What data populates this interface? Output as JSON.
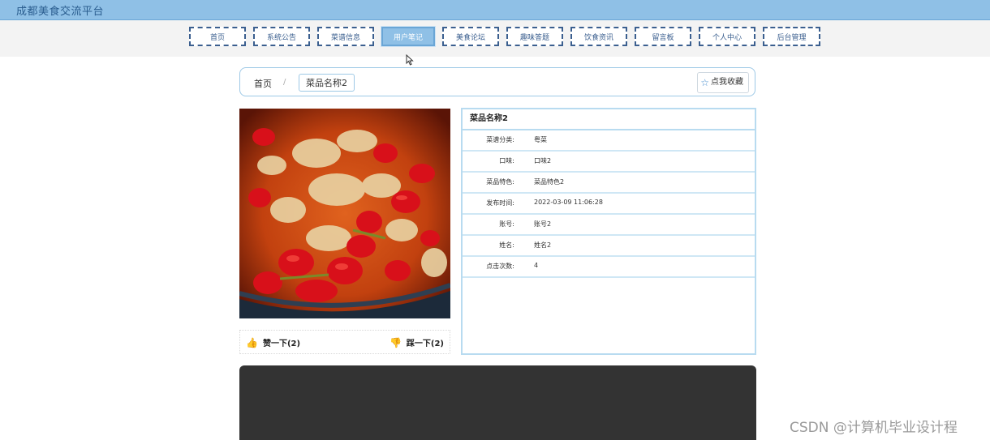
{
  "header": {
    "site_title": "成都美食交流平台",
    "bar_color": "#8fc0e6"
  },
  "nav": {
    "items": [
      {
        "label": "首页",
        "name": "nav-home"
      },
      {
        "label": "系统公告",
        "name": "nav-announcements"
      },
      {
        "label": "菜谱信息",
        "name": "nav-recipes"
      },
      {
        "label": "用户笔记",
        "name": "nav-user-notes",
        "active": true
      },
      {
        "label": "美食论坛",
        "name": "nav-forum"
      },
      {
        "label": "趣味答题",
        "name": "nav-quiz"
      },
      {
        "label": "饮食资讯",
        "name": "nav-news"
      },
      {
        "label": "留言板",
        "name": "nav-message-board"
      },
      {
        "label": "个人中心",
        "name": "nav-profile"
      },
      {
        "label": "后台管理",
        "name": "nav-admin"
      }
    ]
  },
  "breadcrumb": {
    "home": "首页",
    "separator": "/",
    "current": "菜品名称2"
  },
  "favorite_button": {
    "icon": "star-icon",
    "label": "点我收藏"
  },
  "votes": {
    "like": {
      "icon": "thumbs-up-icon",
      "label": "赞一下(2)"
    },
    "dislike": {
      "icon": "thumbs-down-icon",
      "label": "踩一下(2)"
    }
  },
  "detail": {
    "title": "菜品名称2",
    "rows": [
      {
        "label": "菜谱分类:",
        "value": "粤菜"
      },
      {
        "label": "口味:",
        "value": "口味2"
      },
      {
        "label": "菜品特色:",
        "value": "菜品特色2"
      },
      {
        "label": "发布时间:",
        "value": "2022-03-09 11:06:28"
      },
      {
        "label": "账号:",
        "value": "账号2"
      },
      {
        "label": "姓名:",
        "value": "姓名2"
      },
      {
        "label": "点击次数:",
        "value": "4"
      }
    ]
  },
  "watermark": "CSDN @计算机毕业设计程"
}
